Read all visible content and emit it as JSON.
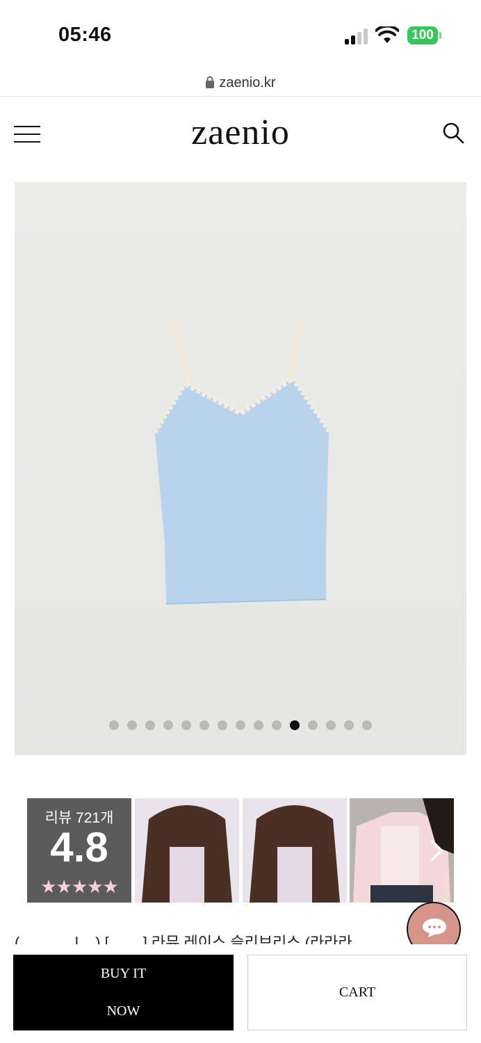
{
  "status_bar": {
    "time": "05:46",
    "battery": "100"
  },
  "browser": {
    "url": "zaenio.kr"
  },
  "header": {
    "logo": "zaenio"
  },
  "gallery": {
    "total_slides": 15,
    "active_index": 10
  },
  "reviews": {
    "count_label": "리뷰 721개",
    "score": "4.8",
    "stars": "★★★★★"
  },
  "product": {
    "name_partial": "(_____ _l__) [____] 라뮤 레이스 슬리브리스 (라라라"
  },
  "actions": {
    "buy_line1": "BUY IT",
    "buy_line2": "NOW",
    "cart": "CART"
  },
  "colors": {
    "battery": "#34c759",
    "chat": "#d7948a",
    "star": "#f7d0dc",
    "top": "#b9d3ec"
  }
}
